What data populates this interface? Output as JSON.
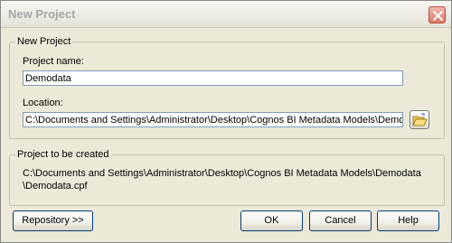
{
  "window": {
    "title": "New Project"
  },
  "new_project_group": {
    "legend": "New Project",
    "project_name_label": "Project name:",
    "project_name_value": "Demodata",
    "location_label": "Location:",
    "location_value": "C:\\Documents and Settings\\Administrator\\Desktop\\Cognos BI Metadata Models\\Demodata"
  },
  "to_be_created_group": {
    "legend": "Project to be created",
    "path_line1": "C:\\Documents and Settings\\Administrator\\Desktop\\Cognos BI Metadata Models\\Demodata",
    "path_line2": "\\Demodata.cpf"
  },
  "buttons": {
    "repository": "Repository >>",
    "ok": "OK",
    "cancel": "Cancel",
    "help": "Help"
  },
  "icons": {
    "close": "close-icon",
    "browse": "folder-open-icon"
  }
}
